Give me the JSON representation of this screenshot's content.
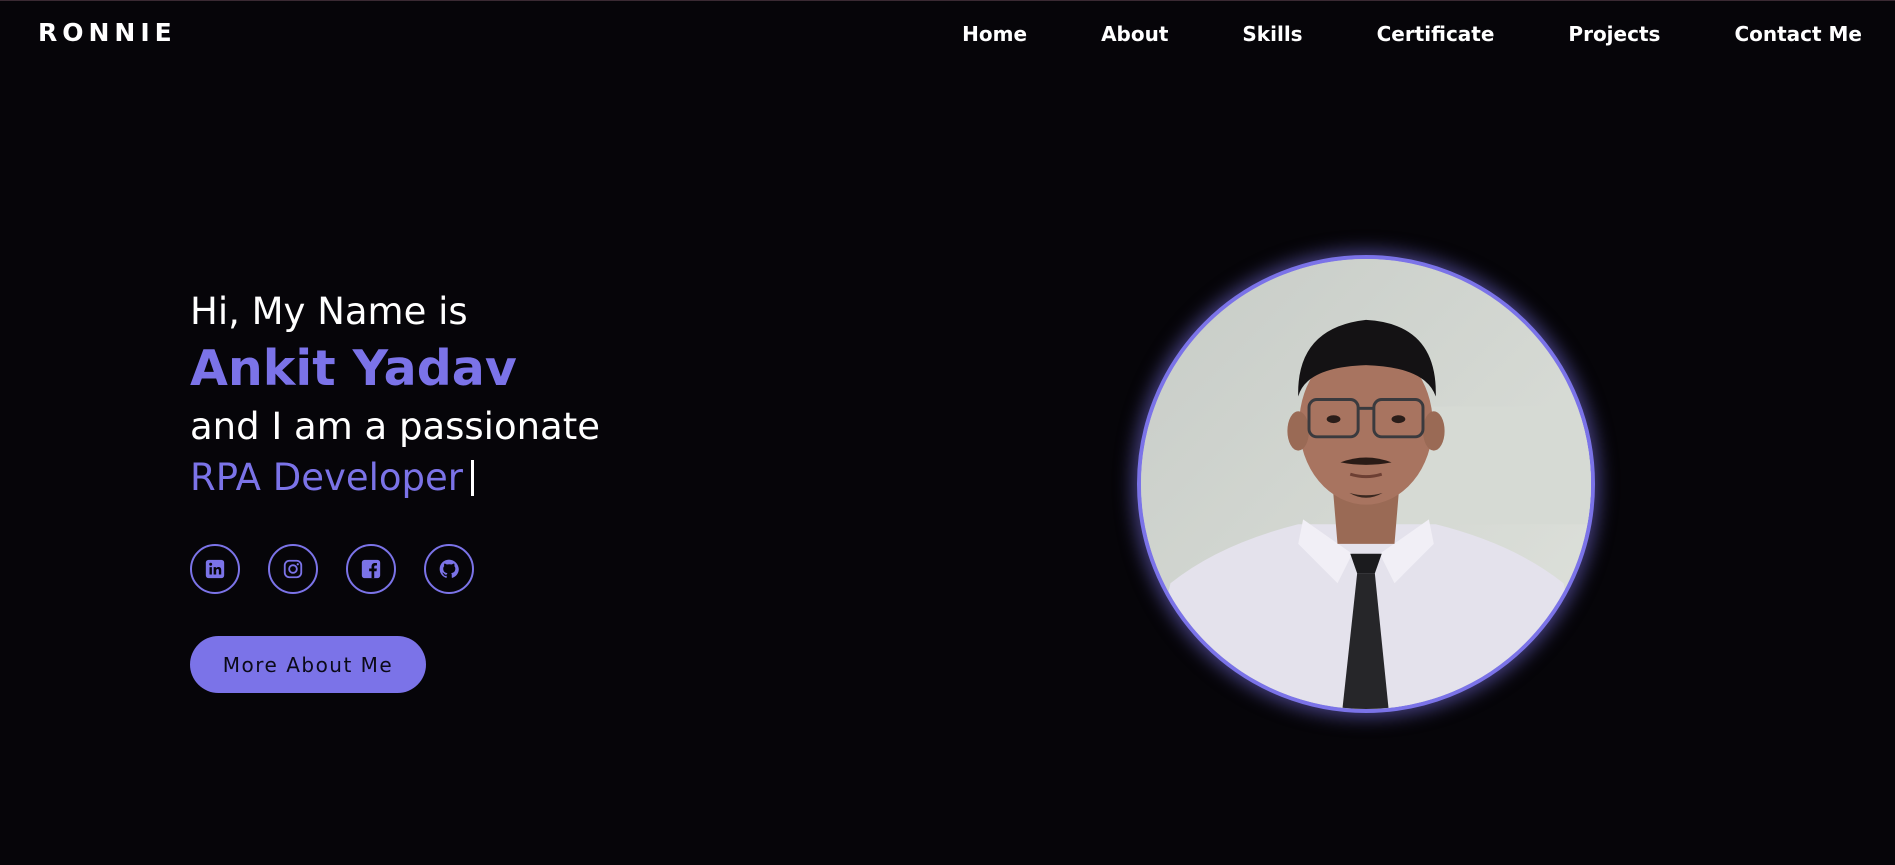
{
  "navbar": {
    "logo": "RONNIE",
    "links": [
      "Home",
      "About",
      "Skills",
      "Certificate",
      "Projects",
      "Contact Me"
    ]
  },
  "hero": {
    "greeting": "Hi, My Name is",
    "name": "Ankit Yadav",
    "intro": "and I am a passionate",
    "role": "RPA Developer",
    "button_label": "More About Me"
  },
  "socials": [
    {
      "icon": "linkedin-icon"
    },
    {
      "icon": "instagram-icon"
    },
    {
      "icon": "facebook-icon"
    },
    {
      "icon": "github-icon"
    }
  ],
  "portrait": {
    "description": "profile-photo"
  },
  "colors": {
    "background": "#060509",
    "accent": "#7b73e8",
    "text": "#ffffff"
  }
}
